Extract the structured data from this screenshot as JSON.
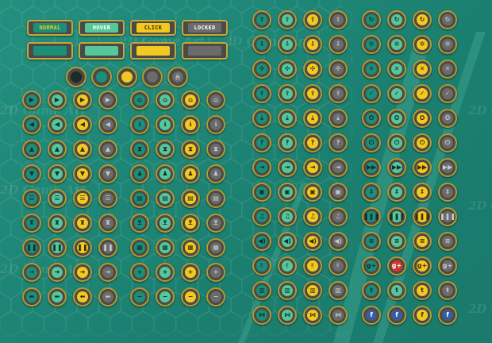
{
  "state_buttons": [
    {
      "id": "normal",
      "label": "NORMAL",
      "fill": "#1b8f7a",
      "text_color": "#f3c820"
    },
    {
      "id": "hover",
      "label": "HOVER",
      "fill": "#55c79b",
      "text_color": "#ffffff"
    },
    {
      "id": "click",
      "label": "CLICK",
      "fill": "#f3c820",
      "text_color": "#3a3000"
    },
    {
      "id": "locked",
      "label": "LOCKED",
      "fill": "#6b6b6b",
      "text_color": "#ffffff"
    }
  ],
  "state_bars": [
    "#1b8f7a",
    "#55c79b",
    "#f3c820",
    "#6b6b6b"
  ],
  "state_rings": [
    {
      "fill": "#1f2a28",
      "icon": ""
    },
    {
      "fill": "#1b8f7a",
      "icon": ""
    },
    {
      "fill": "#f3c820",
      "icon": ""
    },
    {
      "fill": "#6b6b6b",
      "icon": ""
    },
    {
      "fill": "#6b6b6b",
      "icon": "lock-icon"
    }
  ],
  "variants": [
    "normal",
    "hover",
    "click",
    "locked"
  ],
  "colors": {
    "background": "#1f8a7a",
    "frame": "#4a4a47",
    "rim": "#b39b33",
    "normal": "#1b8f7a",
    "hover": "#55c79b",
    "click": "#f3c820",
    "locked": "#6b6b6b",
    "social_red": "#d8332b",
    "social_blue": "#3b5b9a"
  },
  "watermark_text": "2D Game Art",
  "left_groups": [
    [
      {
        "name": "play",
        "glyph": "▶"
      },
      {
        "name": "back",
        "glyph": "◀"
      },
      {
        "name": "up",
        "glyph": "▲"
      },
      {
        "name": "down",
        "glyph": "▼"
      },
      {
        "name": "list",
        "glyph": "☰"
      },
      {
        "name": "trophy",
        "glyph": "♜"
      },
      {
        "name": "pause",
        "glyph": "❚❚"
      },
      {
        "name": "arrow-right",
        "glyph": "➜"
      },
      {
        "name": "arrow-left",
        "glyph": "⬅"
      }
    ],
    [
      {
        "name": "home",
        "glyph": "⌂"
      },
      {
        "name": "info",
        "glyph": "ℹ"
      },
      {
        "name": "hourglass",
        "glyph": "⧗"
      },
      {
        "name": "group",
        "glyph": "♟"
      },
      {
        "name": "document",
        "glyph": "▤"
      },
      {
        "name": "cart",
        "glyph": "⊻"
      },
      {
        "name": "grid",
        "glyph": "▦"
      },
      {
        "name": "plus",
        "glyph": "+"
      },
      {
        "name": "minus",
        "glyph": "−"
      }
    ]
  ],
  "right_groups": [
    [
      {
        "name": "upload",
        "glyph": "⇧"
      },
      {
        "name": "download",
        "glyph": "⇩"
      },
      {
        "name": "gamepad",
        "glyph": "✣"
      },
      {
        "name": "export",
        "glyph": "⇪"
      },
      {
        "name": "import",
        "glyph": "⤓"
      },
      {
        "name": "question",
        "glyph": "?"
      },
      {
        "name": "exit",
        "glyph": "⇥"
      },
      {
        "name": "save",
        "glyph": "▣"
      },
      {
        "name": "music",
        "glyph": "♫"
      },
      {
        "name": "sound",
        "glyph": "◀)"
      },
      {
        "name": "like",
        "glyph": "✌"
      },
      {
        "name": "leaderboard",
        "glyph": "▥"
      },
      {
        "name": "share",
        "glyph": "⋈"
      }
    ],
    [
      {
        "name": "refresh",
        "glyph": "↻"
      },
      {
        "name": "settings",
        "glyph": "✲"
      },
      {
        "name": "close",
        "glyph": "✕"
      },
      {
        "name": "check",
        "glyph": "✓"
      },
      {
        "name": "award",
        "glyph": "✪"
      },
      {
        "name": "power",
        "glyph": "⏻"
      },
      {
        "name": "fast-forward",
        "glyph": "▶▶"
      },
      {
        "name": "resize",
        "glyph": "⇕"
      },
      {
        "name": "stop",
        "glyph": "❚❚❚"
      },
      {
        "name": "menu",
        "glyph": "≡"
      },
      {
        "name": "google-plus",
        "glyph": "g+"
      },
      {
        "name": "twitter",
        "glyph": "t"
      },
      {
        "name": "facebook",
        "glyph": "f"
      }
    ]
  ]
}
